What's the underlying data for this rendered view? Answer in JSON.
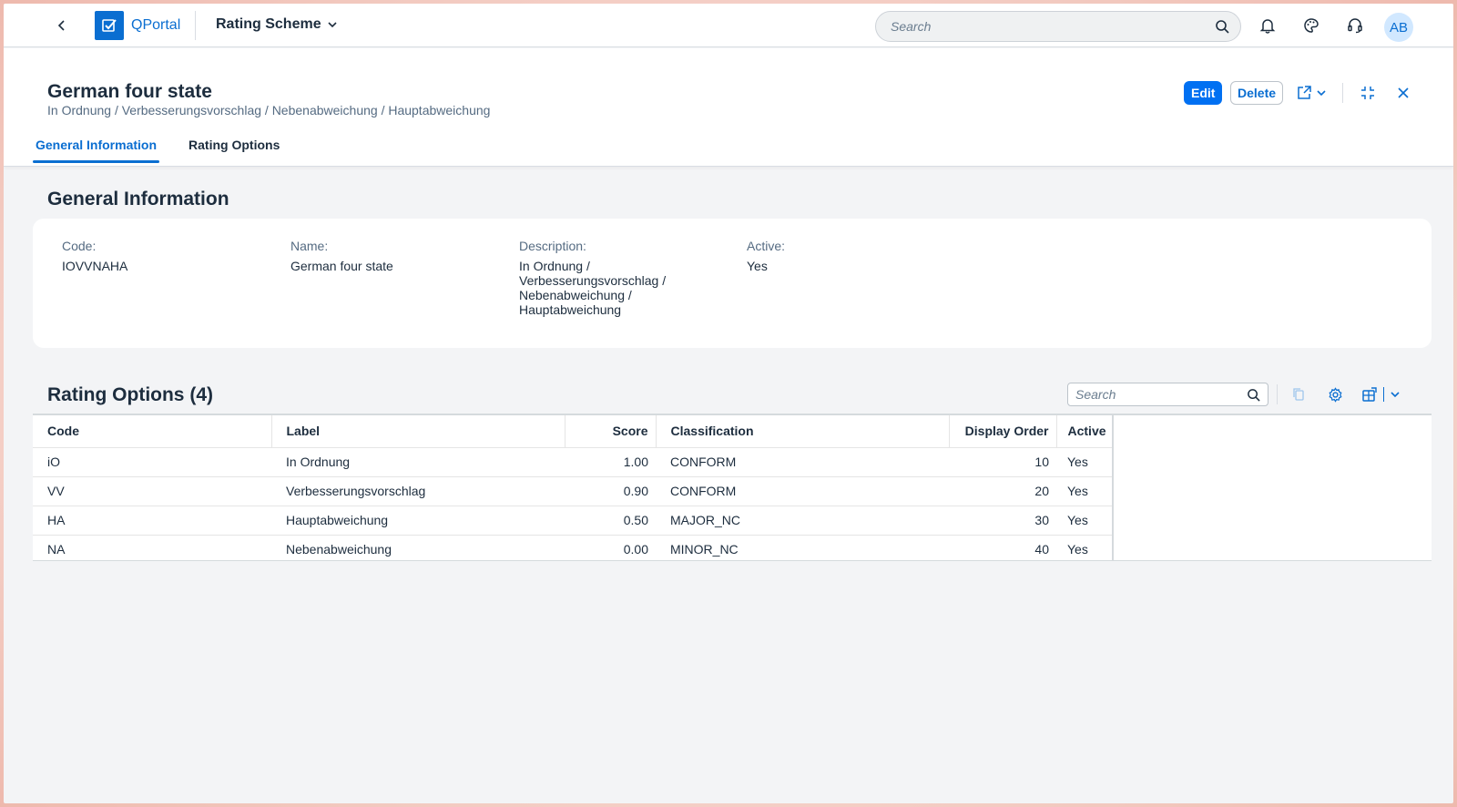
{
  "shell": {
    "brand": "QPortal",
    "app_title": "Rating Scheme",
    "search_placeholder": "Search",
    "avatar_initials": "AB"
  },
  "header": {
    "title": "German four state",
    "subtitle": "In Ordnung / Verbesserungsvorschlag / Nebenabweichung / Hauptabweichung",
    "edit_label": "Edit",
    "delete_label": "Delete",
    "tabs": [
      "General Information",
      "Rating Options"
    ]
  },
  "general": {
    "title": "General Information",
    "fields": [
      {
        "label": "Code:",
        "value": "IOVVNAHA"
      },
      {
        "label": "Name:",
        "value": "German four state"
      },
      {
        "label": "Description:",
        "lines": [
          "In Ordnung /",
          "Verbesserungsvorschlag /",
          "Nebenabweichung /",
          "Hauptabweichung"
        ]
      },
      {
        "label": "Active:",
        "value": "Yes"
      }
    ]
  },
  "rating_options": {
    "title": "Rating Options (4)",
    "search_placeholder": "Search",
    "columns": [
      "Code",
      "Label",
      "Score",
      "Classification",
      "Display Order",
      "Active"
    ],
    "rows": [
      {
        "code": "iO",
        "label": "In Ordnung",
        "score": "1.00",
        "classification": "CONFORM",
        "order": "10",
        "active": "Yes"
      },
      {
        "code": "VV",
        "label": "Verbesserungsvorschlag",
        "score": "0.90",
        "classification": "CONFORM",
        "order": "20",
        "active": "Yes"
      },
      {
        "code": "HA",
        "label": "Hauptabweichung",
        "score": "0.50",
        "classification": "MAJOR_NC",
        "order": "30",
        "active": "Yes"
      },
      {
        "code": "NA",
        "label": "Nebenabweichung",
        "score": "0.00",
        "classification": "MINOR_NC",
        "order": "40",
        "active": "Yes"
      }
    ]
  },
  "colors": {
    "accent": "#0a6ed1",
    "edit_button": "#0070f2",
    "background": "#f3f4f6"
  }
}
